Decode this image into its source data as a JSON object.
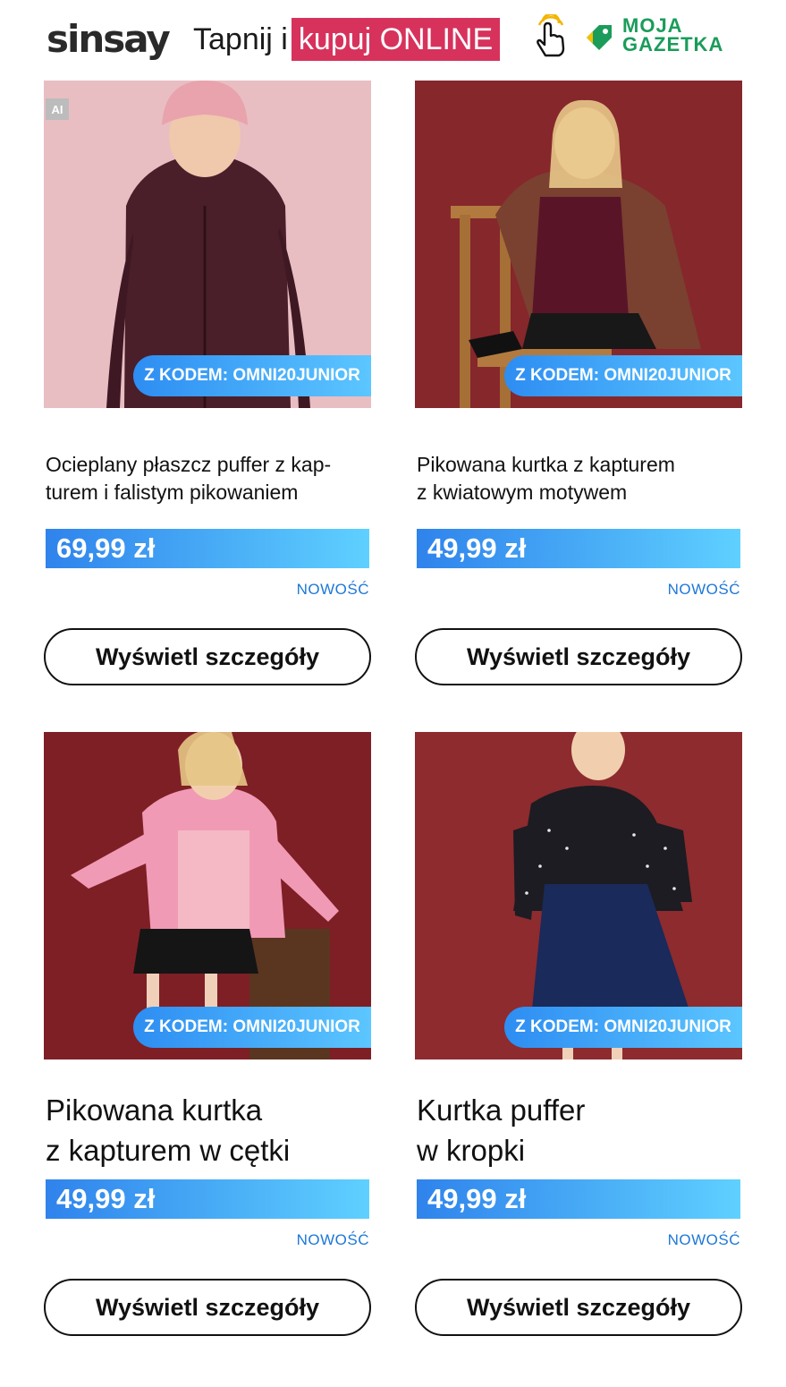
{
  "header": {
    "brand": "sinsay",
    "tagline_plain": "Tapnij i",
    "tagline_highlight": "kupuj ONLINE",
    "hand_icon": "pointing-hand-icon",
    "partner_logo_text_1": "MOJA",
    "partner_logo_text_2": "GAZETKA",
    "colors": {
      "highlight": "#d7325c",
      "partner_green": "#1b9c5a"
    }
  },
  "products": [
    {
      "title_line1": "Ocieplany płaszcz puffer z kap-",
      "title_line2": "turem i falistym pikowaniem",
      "price": "69,99 zł",
      "promo": "Z KODEM: OMNI20JUNIOR",
      "badge": "NOWOŚĆ",
      "button": "Wyświetl szczegóły",
      "ai_badge": "AI"
    },
    {
      "title_line1": "Pikowana kurtka z kapturem",
      "title_line2": "z kwiatowym motywem",
      "price": "49,99 zł",
      "promo": "Z KODEM: OMNI20JUNIOR",
      "badge": "NOWOŚĆ",
      "button": "Wyświetl szczegóły"
    },
    {
      "title_line1": "Pikowana kurtka",
      "title_line2": "z kapturem w cętki",
      "price": "49,99 zł",
      "promo": "Z KODEM: OMNI20JUNIOR",
      "badge": "NOWOŚĆ",
      "button": "Wyświetl szczegóły"
    },
    {
      "title_line1": "Kurtka puffer",
      "title_line2": "w kropki",
      "price": "49,99 zł",
      "promo": "Z KODEM: OMNI20JUNIOR",
      "badge": "NOWOŚĆ",
      "button": "Wyświetl szczegóły"
    }
  ],
  "colors": {
    "promo_gradient": [
      "#2d8df2",
      "#5cc6ff"
    ],
    "price_gradient": [
      "#2f83ec",
      "#5fd0ff"
    ],
    "new_badge": "#1d77d8"
  }
}
